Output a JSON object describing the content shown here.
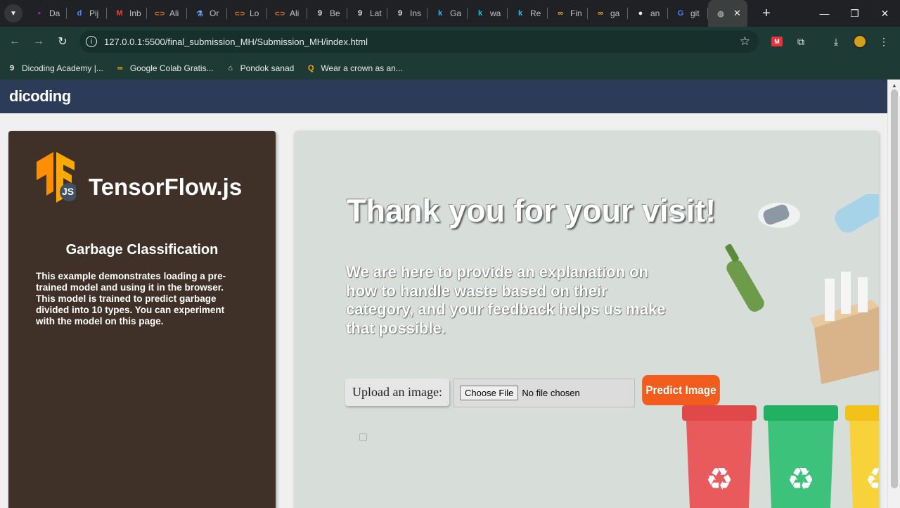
{
  "browser": {
    "tabs": [
      {
        "label": "Da",
        "icon": "mx-icon",
        "color": "#c51fd6"
      },
      {
        "label": "Pij",
        "icon": "dir-icon",
        "color": "#4a8cff"
      },
      {
        "label": "Inb",
        "icon": "gmail-icon",
        "color": "#ea4335"
      },
      {
        "label": "Ali",
        "icon": "link-icon",
        "color": "#f07a2a"
      },
      {
        "label": "Or",
        "icon": "flask-icon",
        "color": "#6aa5ff"
      },
      {
        "label": "Lo",
        "icon": "link-icon",
        "color": "#f07a2a"
      },
      {
        "label": "Ali",
        "icon": "link-icon",
        "color": "#f07a2a"
      },
      {
        "label": "Be",
        "icon": "dicoding-icon",
        "color": "#e8eaed"
      },
      {
        "label": "Lat",
        "icon": "dicoding-icon",
        "color": "#e8eaed"
      },
      {
        "label": "Ins",
        "icon": "dicoding-icon",
        "color": "#e8eaed"
      },
      {
        "label": "Ga",
        "icon": "kaggle-icon",
        "color": "#20beff"
      },
      {
        "label": "wa",
        "icon": "kaggle-icon",
        "color": "#20beff"
      },
      {
        "label": "Re",
        "icon": "kaggle-icon",
        "color": "#20beff"
      },
      {
        "label": "Fin",
        "icon": "infinity-icon",
        "color": "#f5a623"
      },
      {
        "label": "ga",
        "icon": "infinity-icon",
        "color": "#f5a623"
      },
      {
        "label": "an",
        "icon": "github-icon",
        "color": "#e8eaed"
      },
      {
        "label": "git",
        "icon": "google-icon",
        "color": "#4285f4"
      }
    ],
    "active_tab_close": "✕",
    "new_tab": "+",
    "window_controls": [
      "—",
      "❐",
      "✕"
    ],
    "url": "127.0.0.1:5500/final_submission_MH/Submission_MH/index.html",
    "bookmarks": [
      {
        "label": "Dicoding Academy |...",
        "icon": "dicoding-icon"
      },
      {
        "label": "Google Colab Gratis...",
        "icon": "colab-icon"
      },
      {
        "label": "Pondok sanad",
        "icon": "house-icon"
      },
      {
        "label": "Wear a crown as an...",
        "icon": "q-icon"
      }
    ]
  },
  "site": {
    "logo": "dicoding",
    "sidebar": {
      "brand": "TensorFlow.js",
      "badge": "JS",
      "title": "Garbage Classification",
      "description": "This example demonstrates loading a pre-trained model and using it in the browser. This model is trained to predict garbage divided into 10 types. You can experiment with the model on this page."
    },
    "main": {
      "headline": "Thank you for your visit!",
      "subtext": "We are here to provide an explanation on how to handle waste based on their category, and your feedback helps us make that possible.",
      "upload_label": "Upload an image:",
      "choose_file": "Choose File",
      "no_file": "No file chosen",
      "predict_button": "Predict Image"
    },
    "colors": {
      "navbar": "#2b3b58",
      "sidebar": "#3f3028",
      "accent": "#f25c1c",
      "tensorflow_orange": "#ff8f00"
    }
  }
}
